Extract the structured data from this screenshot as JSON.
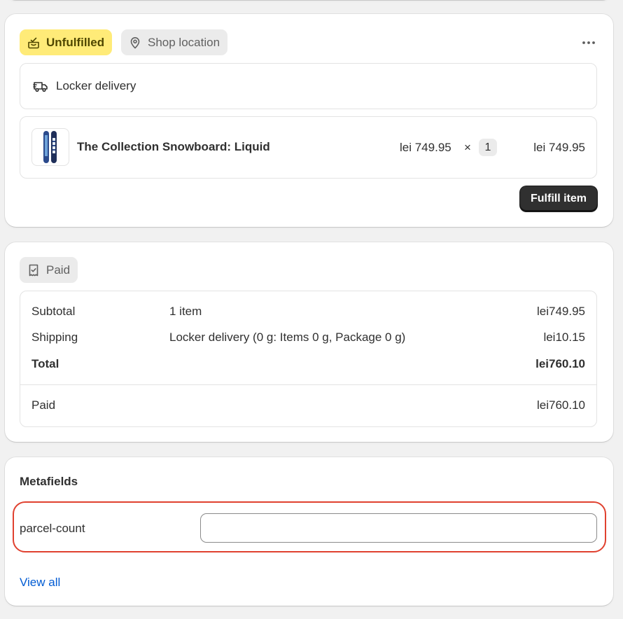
{
  "fulfillment": {
    "status_label": "Unfulfilled",
    "location_label": "Shop location",
    "delivery_method": "Locker delivery",
    "item": {
      "title": "The Collection Snowboard: Liquid",
      "unit_price": "lei 749.95",
      "times": "×",
      "quantity": "1",
      "line_total": "lei 749.95"
    },
    "fulfill_button": "Fulfill item"
  },
  "payment": {
    "status_label": "Paid",
    "rows": [
      {
        "label": "Subtotal",
        "detail": "1 item",
        "amount": "lei749.95"
      },
      {
        "label": "Shipping",
        "detail": "Locker delivery (0 g: Items 0 g, Package 0 g)",
        "amount": "lei10.15"
      },
      {
        "label": "Total",
        "detail": "",
        "amount": "lei760.10"
      }
    ],
    "paid_row": {
      "label": "Paid",
      "amount": "lei760.10"
    }
  },
  "metafields": {
    "heading": "Metafields",
    "field_label": "parcel-count",
    "field_value": "",
    "view_all": "View all"
  },
  "colors": {
    "unfulfilled_bg": "#ffeb78",
    "highlight_border": "#e0412f",
    "link": "#005bd3",
    "primary_button": "#303030"
  },
  "icons": {
    "unfulfilled": "fulfillment-box-icon",
    "location": "map-pin-icon",
    "more": "more-horizontal-icon",
    "delivery": "delivery-truck-icon",
    "paid": "receipt-check-icon"
  }
}
